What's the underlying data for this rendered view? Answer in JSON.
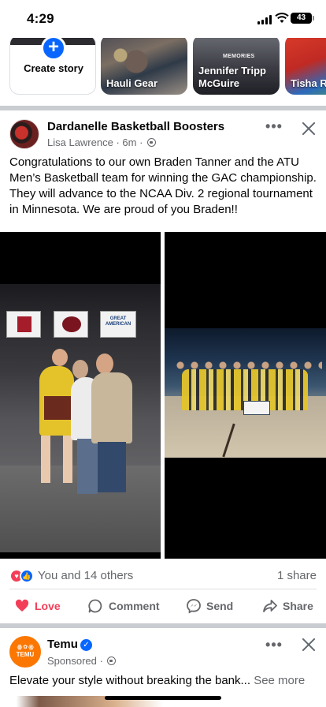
{
  "status_bar": {
    "time": "4:29",
    "battery": "43"
  },
  "stories": {
    "create_label": "Create story",
    "items": [
      {
        "name": "Hauli Gear"
      },
      {
        "name": "Jennifer Tripp McGuire",
        "overlay_text": "MEMORIES"
      },
      {
        "name": "Tisha Richard"
      }
    ]
  },
  "post": {
    "page_name": "Dardanelle Basketball Boosters",
    "author": "Lisa Lawrence",
    "time": "6m",
    "separator": "·",
    "body": "Congratulations to our own Braden Tanner and the ATU Men’s Basketball team for winning the GAC championship.  They will advance to the NCAA Div. 2 regional tournament in Minnesota.  We are proud of you Braden!!",
    "photo_banners": [
      "",
      "",
      "GREAT AMERICAN"
    ],
    "reactions_text": "You and 14 others",
    "shares": "1 share",
    "actions": {
      "love": "Love",
      "comment": "Comment",
      "send": "Send",
      "share": "Share"
    }
  },
  "ad_post": {
    "name": "Temu",
    "logo_text": "TEMU",
    "sponsored": "Sponsored",
    "separator": "·",
    "body": "Elevate your style without breaking the bank...",
    "see_more": "See more"
  },
  "colors": {
    "accent": "#0866ff",
    "love": "#f33e58",
    "temu": "#fb7701",
    "meta_text": "#65676b"
  },
  "icons": [
    "plus-icon",
    "globe-icon",
    "more-icon",
    "close-icon",
    "heart-reaction-icon",
    "like-reaction-icon",
    "heart-outline-icon",
    "comment-icon",
    "messenger-icon",
    "share-icon",
    "verified-badge-icon"
  ]
}
